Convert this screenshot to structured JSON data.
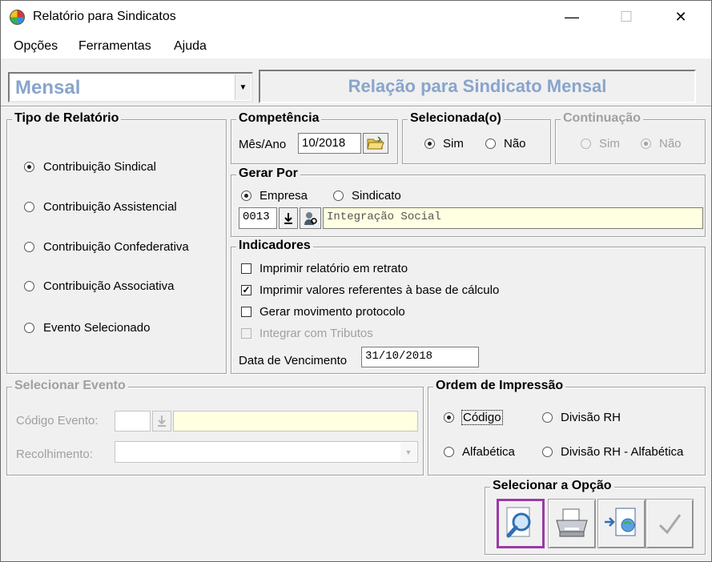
{
  "window": {
    "title": "Relatório para Sindicatos",
    "minimize": "—",
    "maximize": "☐",
    "close": "✕"
  },
  "menu": [
    {
      "label": "Opções"
    },
    {
      "label": "Ferramentas"
    },
    {
      "label": "Ajuda"
    }
  ],
  "period_combo": {
    "value": "Mensal"
  },
  "banner": {
    "text": "Relação para Sindicato Mensal"
  },
  "tipo_relatorio": {
    "title": "Tipo de Relatório",
    "options": [
      {
        "label": "Contribuição Sindical",
        "checked": true
      },
      {
        "label": "Contribuição Assistencial",
        "checked": false
      },
      {
        "label": "Contribuição Confederativa",
        "checked": false
      },
      {
        "label": "Contribuição Associativa",
        "checked": false
      },
      {
        "label": "Evento Selecionado",
        "checked": false
      }
    ]
  },
  "competencia": {
    "title": "Competência",
    "label": "Mês/Ano",
    "value": "10/2018"
  },
  "selecionada": {
    "title": "Selecionada(o)",
    "sim": "Sim",
    "nao": "Não",
    "selected": "Sim"
  },
  "continuacao": {
    "title": "Continuação",
    "sim": "Sim",
    "nao": "Não",
    "selected": "Não",
    "enabled": false
  },
  "gerar_por": {
    "title": "Gerar Por",
    "empresa": "Empresa",
    "sindicato": "Sindicato",
    "selected": "Empresa",
    "code": "0013",
    "name": "Integração Social"
  },
  "indicadores": {
    "title": "Indicadores",
    "items": [
      {
        "label": "Imprimir relatório em retrato",
        "checked": false,
        "enabled": true
      },
      {
        "label": "Imprimir valores referentes à base de cálculo",
        "checked": true,
        "enabled": true
      },
      {
        "label": "Gerar movimento protocolo",
        "checked": false,
        "enabled": true
      },
      {
        "label": "Integrar com Tributos",
        "checked": false,
        "enabled": false
      }
    ],
    "vencimento_label": "Data de Vencimento",
    "vencimento_value": "31/10/2018"
  },
  "selecionar_evento": {
    "title": "Selecionar Evento",
    "codigo_label": "Código Evento:",
    "recolhimento_label": "Recolhimento:",
    "enabled": false
  },
  "ordem": {
    "title": "Ordem de Impressão",
    "options": [
      {
        "label": "Código",
        "checked": true
      },
      {
        "label": "Divisão RH",
        "checked": false
      },
      {
        "label": "Alfabética",
        "checked": false
      },
      {
        "label": "Divisão RH - Alfabética",
        "checked": false
      }
    ]
  },
  "acoes": {
    "title": "Selecionar a Opção",
    "buttons": [
      {
        "icon": "preview-magnifier-icon",
        "selected": true
      },
      {
        "icon": "printer-icon",
        "selected": false
      },
      {
        "icon": "export-document-icon",
        "selected": false
      },
      {
        "icon": "checkmark-icon",
        "selected": false
      }
    ]
  }
}
